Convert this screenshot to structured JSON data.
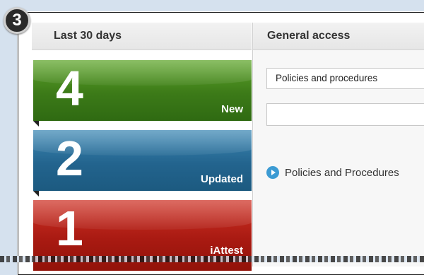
{
  "step_badge": "3",
  "left_panel": {
    "title": "Last 30 days",
    "tiles": [
      {
        "count": "4",
        "label": "New",
        "color": "#3c7a18"
      },
      {
        "count": "2",
        "label": "Updated",
        "color": "#23648e"
      },
      {
        "count": "1",
        "label": "iAttest",
        "color": "#a91a12"
      }
    ]
  },
  "right_panel": {
    "title": "General access",
    "select": {
      "value": "Policies and procedures"
    },
    "input": {
      "value": "",
      "placeholder": ""
    },
    "link": {
      "label": "Policies and Procedures",
      "icon": "play-circle-icon"
    }
  }
}
